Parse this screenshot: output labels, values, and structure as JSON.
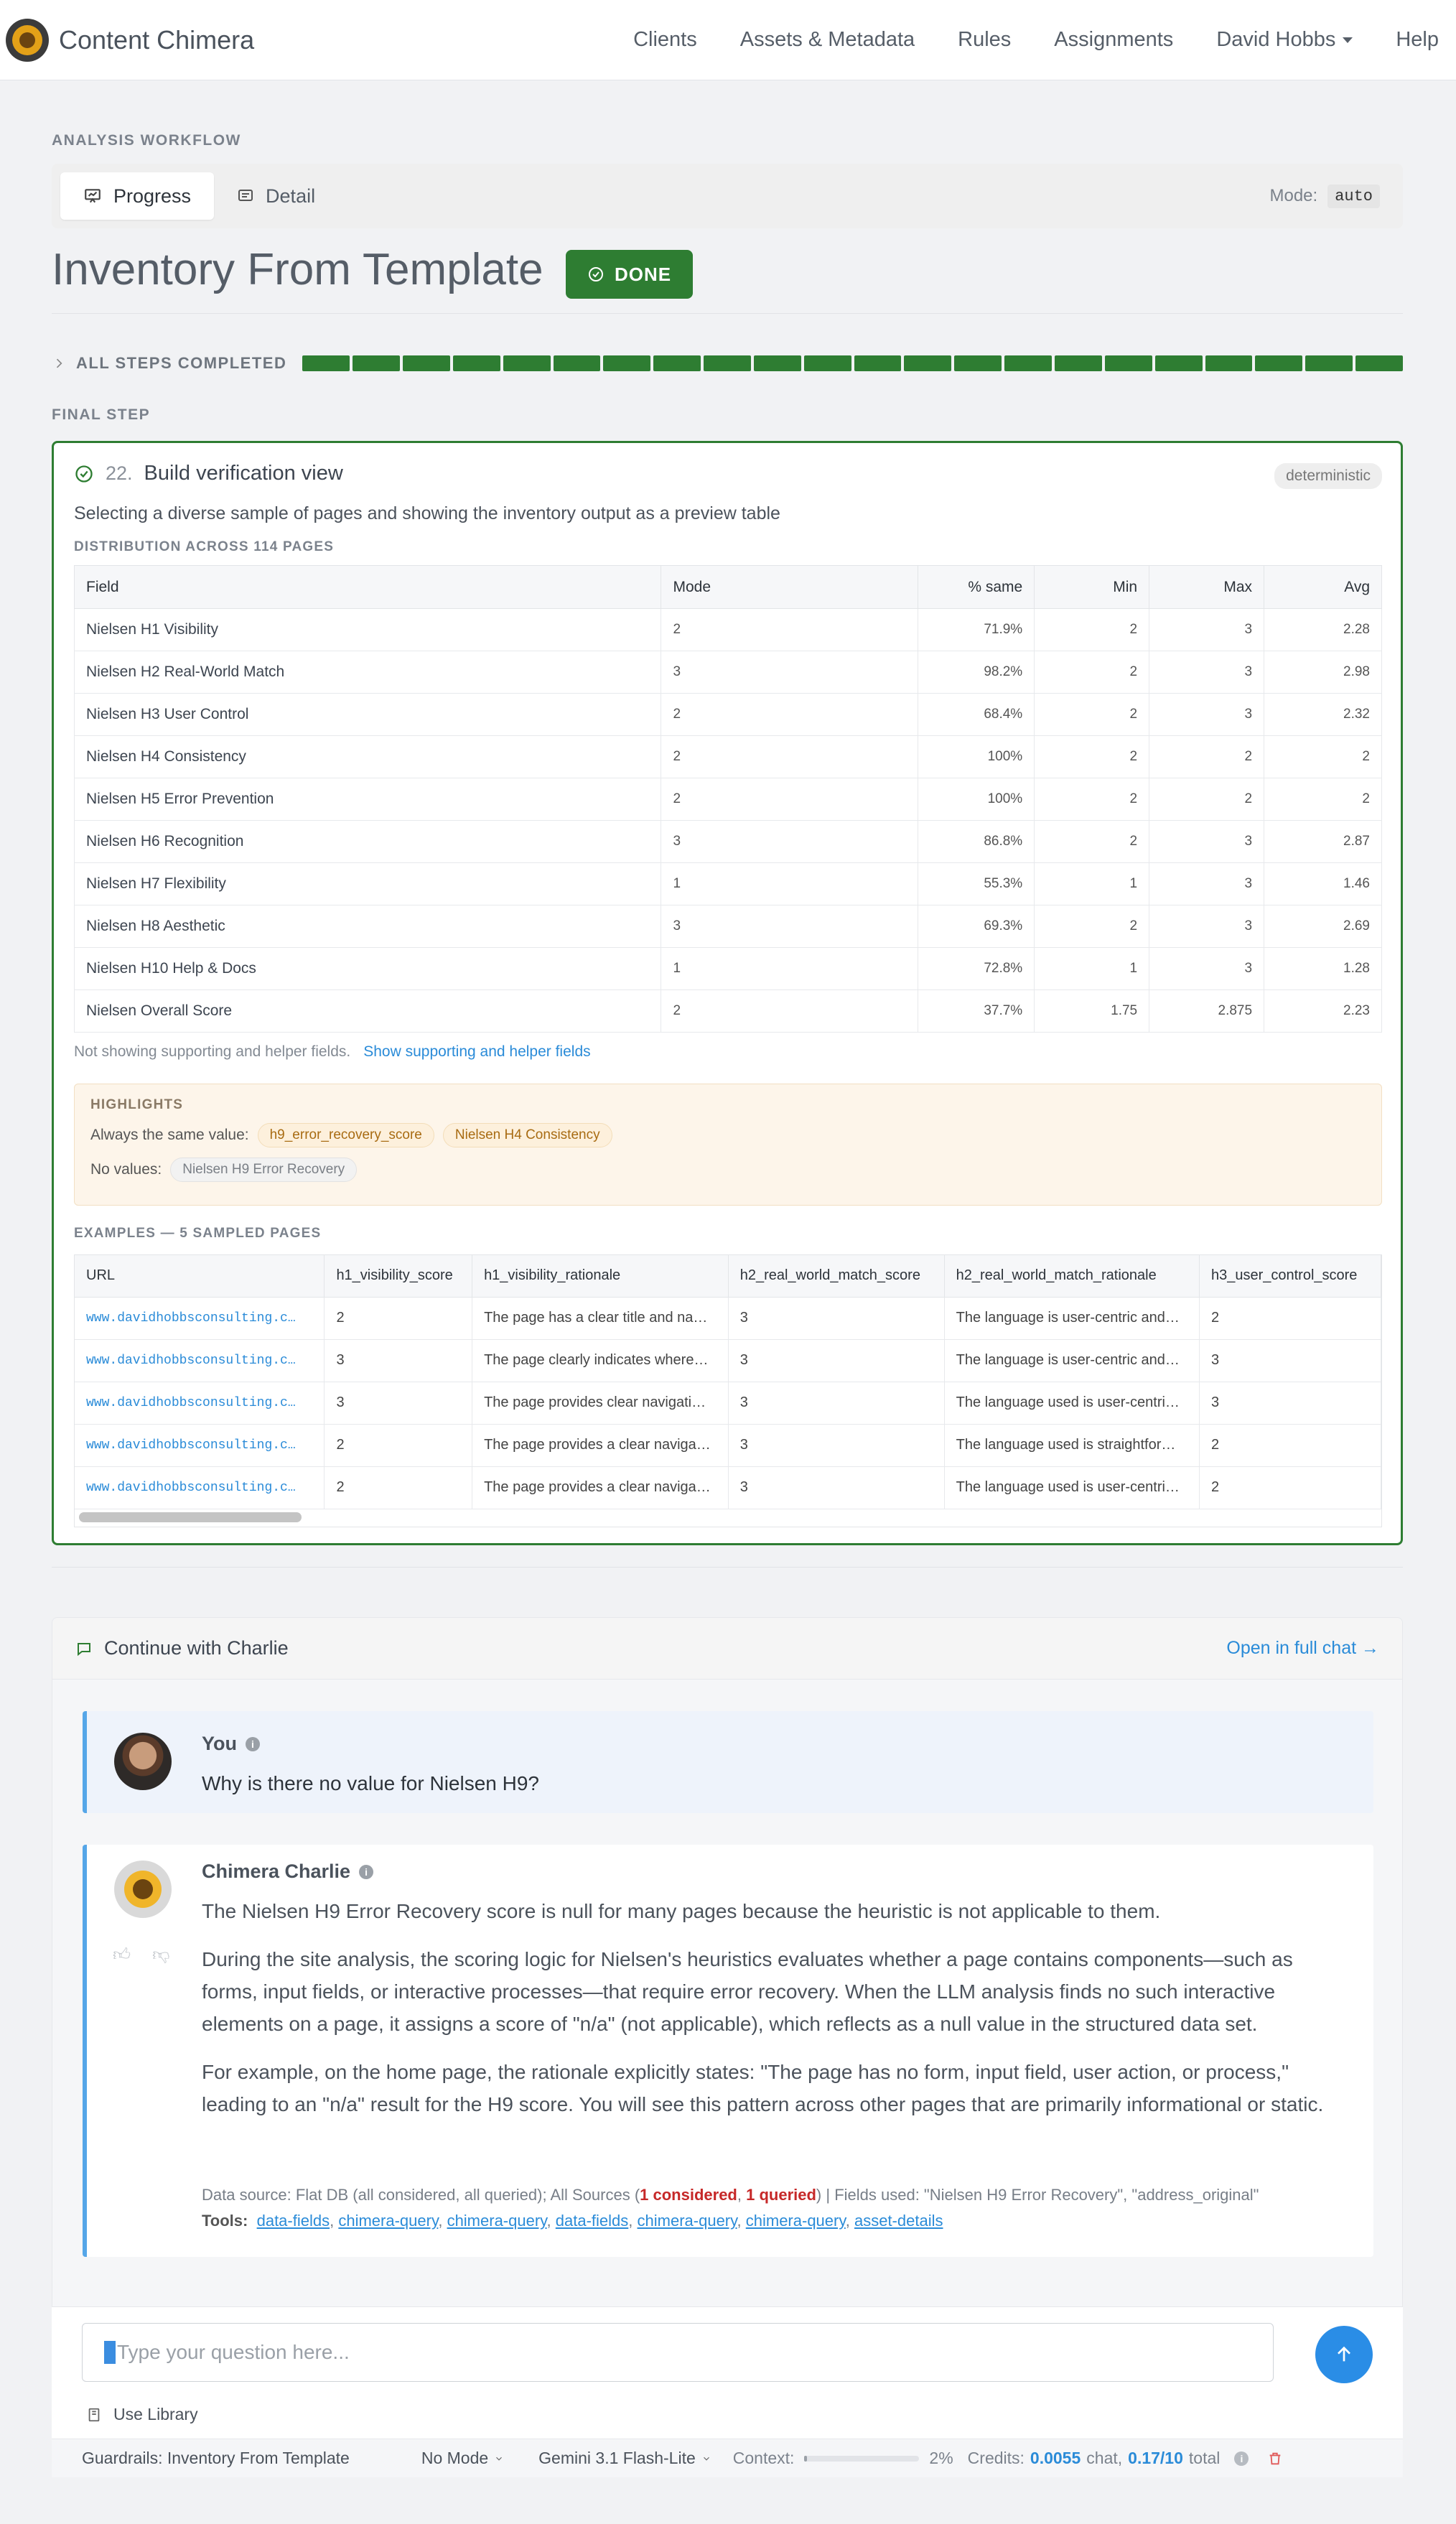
{
  "app": {
    "name": "Content Chimera"
  },
  "nav": {
    "items": [
      "Clients",
      "Assets & Metadata",
      "Rules",
      "Assignments",
      "David Hobbs",
      "Help"
    ]
  },
  "workflow": {
    "section_label": "ANALYSIS WORKFLOW",
    "tabs": [
      {
        "label": "Progress",
        "active": true
      },
      {
        "label": "Detail",
        "active": false
      }
    ],
    "mode_label": "Mode:",
    "mode_value": "auto",
    "title": "Inventory From Template",
    "status": "DONE",
    "steps_label": "ALL STEPS COMPLETED",
    "steps_completed": 22,
    "steps_total": 22
  },
  "final_step": {
    "section_label": "FINAL STEP",
    "number": "22.",
    "title": "Build verification view",
    "badge": "deterministic",
    "description": "Selecting a diverse sample of pages and showing the inventory output as a preview table",
    "distribution_label": "DISTRIBUTION ACROSS 114 PAGES",
    "columns": [
      "Field",
      "Mode",
      "% same",
      "Min",
      "Max",
      "Avg"
    ],
    "rows": [
      [
        "Nielsen H1 Visibility",
        "2",
        "71.9%",
        "2",
        "3",
        "2.28"
      ],
      [
        "Nielsen H2 Real-World Match",
        "3",
        "98.2%",
        "2",
        "3",
        "2.98"
      ],
      [
        "Nielsen H3 User Control",
        "2",
        "68.4%",
        "2",
        "3",
        "2.32"
      ],
      [
        "Nielsen H4 Consistency",
        "2",
        "100%",
        "2",
        "2",
        "2"
      ],
      [
        "Nielsen H5 Error Prevention",
        "2",
        "100%",
        "2",
        "2",
        "2"
      ],
      [
        "Nielsen H6 Recognition",
        "3",
        "86.8%",
        "2",
        "3",
        "2.87"
      ],
      [
        "Nielsen H7 Flexibility",
        "1",
        "55.3%",
        "1",
        "3",
        "1.46"
      ],
      [
        "Nielsen H8 Aesthetic",
        "3",
        "69.3%",
        "2",
        "3",
        "2.69"
      ],
      [
        "Nielsen H10 Help & Docs",
        "1",
        "72.8%",
        "1",
        "3",
        "1.28"
      ],
      [
        "Nielsen Overall Score",
        "2",
        "37.7%",
        "1.75",
        "2.875",
        "2.23"
      ]
    ],
    "not_showing": "Not showing supporting and helper fields.",
    "show_link": "Show supporting and helper fields",
    "highlights": {
      "label": "HIGHLIGHTS",
      "always_same_label": "Always the same value:",
      "always_same": [
        "h9_error_recovery_score",
        "Nielsen H4 Consistency"
      ],
      "no_values_label": "No values:",
      "no_values": [
        "Nielsen H9 Error Recovery"
      ]
    },
    "examples_label": "EXAMPLES — 5 SAMPLED PAGES",
    "example_columns": [
      "URL",
      "h1_visibility_score",
      "h1_visibility_rationale",
      "h2_real_world_match_score",
      "h2_real_world_match_rationale",
      "h3_user_control_score"
    ],
    "examples": [
      [
        "www.davidhobbsconsulting.c…",
        "2",
        "The page has a clear title and na…",
        "3",
        "The language is user-centric and…",
        "2"
      ],
      [
        "www.davidhobbsconsulting.c…",
        "3",
        "The page clearly indicates where…",
        "3",
        "The language is user-centric and…",
        "3"
      ],
      [
        "www.davidhobbsconsulting.c…",
        "3",
        "The page provides clear navigati…",
        "3",
        "The language used is user-centri…",
        "3"
      ],
      [
        "www.davidhobbsconsulting.c…",
        "2",
        "The page provides a clear naviga…",
        "3",
        "The language used is straightfor…",
        "2"
      ],
      [
        "www.davidhobbsconsulting.c…",
        "2",
        "The page provides a clear naviga…",
        "3",
        "The language used is user-centri…",
        "2"
      ]
    ]
  },
  "chat": {
    "title": "Continue with Charlie",
    "open_full": "Open in full chat →",
    "user": {
      "name": "You",
      "message": "Why is there no value for Nielsen H9?"
    },
    "bot": {
      "name": "Chimera Charlie",
      "paragraphs": [
        "The Nielsen H9 Error Recovery score is null for many pages because the heuristic is not applicable to them.",
        "During the site analysis, the scoring logic for Nielsen's heuristics evaluates whether a page contains components—such as forms, input fields, or interactive processes—that require error recovery. When the LLM analysis finds no such interactive elements on a page, it assigns a score of \"n/a\" (not applicable), which reflects as a null value in the structured data set.",
        "For example, on the home page, the rationale explicitly states: \"The page has no form, input field, user action, or process,\" leading to an \"n/a\" result for the H9 score. You will see this pattern across other pages that are primarily informational or static."
      ],
      "meta_prefix": "Data source: Flat DB (all considered, all queried); All Sources (",
      "meta_considered": "1 considered",
      "meta_sep": ", ",
      "meta_queried": "1 queried",
      "meta_suffix": ") | Fields used: \"Nielsen H9 Error Recovery\", \"address_original\"",
      "tools_label": "Tools:",
      "tools": [
        "data-fields",
        "chimera-query",
        "chimera-query",
        "data-fields",
        "chimera-query",
        "chimera-query",
        "asset-details"
      ]
    },
    "input_placeholder": "Type your question here...",
    "use_library": "Use Library"
  },
  "status_bar": {
    "guardrails": "Guardrails: Inventory From Template",
    "mode": "No Mode",
    "model": "Gemini 3.1 Flash-Lite",
    "context_label": "Context:",
    "context_pct": "2%",
    "context_fraction": 0.02,
    "credits_label": "Credits:",
    "credits_chat": "0.0055",
    "chat_label": "chat,",
    "credits_total": "0.17/10",
    "total_label": "total"
  },
  "colors": {
    "success": "#2e7d32",
    "link": "#2a8bd8",
    "accent_blue": "#55a6e8"
  }
}
